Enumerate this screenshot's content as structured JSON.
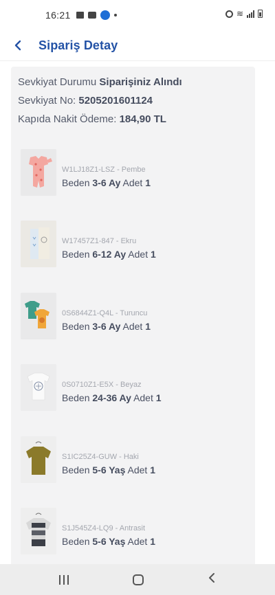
{
  "status_bar": {
    "time": "16:21"
  },
  "header": {
    "title": "Sipariş Detay"
  },
  "summary": {
    "shipment_status_label": "Sevkiyat Durumu",
    "shipment_status_value": "Siparişiniz Alındı",
    "shipment_no_label": "Sevkiyat No:",
    "shipment_no_value": "5205201601124",
    "cod_label": "Kapıda Nakit Ödeme:",
    "cod_value": "184,90 TL"
  },
  "labels": {
    "size": "Beden",
    "qty": "Adet"
  },
  "items": [
    {
      "sku": "W1LJ18Z1-LSZ - Pembe",
      "size": "3-6 Ay",
      "qty": "1"
    },
    {
      "sku": "W17457Z1-847 - Ekru",
      "size": "6-12 Ay",
      "qty": "1"
    },
    {
      "sku": "0S6844Z1-Q4L - Turuncu",
      "size": "3-6 Ay",
      "qty": "1"
    },
    {
      "sku": "0S0710Z1-E5X - Beyaz",
      "size": "24-36 Ay",
      "qty": "1"
    },
    {
      "sku": "S1IC25Z4-GUW - Haki",
      "size": "5-6 Yaş",
      "qty": "1"
    },
    {
      "sku": "S1J545Z4-LQ9 - Antrasit",
      "size": "5-6 Yaş",
      "qty": "1"
    }
  ],
  "colors": {
    "accent": "#2453a6",
    "card_bg": "#f3f3f4",
    "text": "#4b5163"
  }
}
